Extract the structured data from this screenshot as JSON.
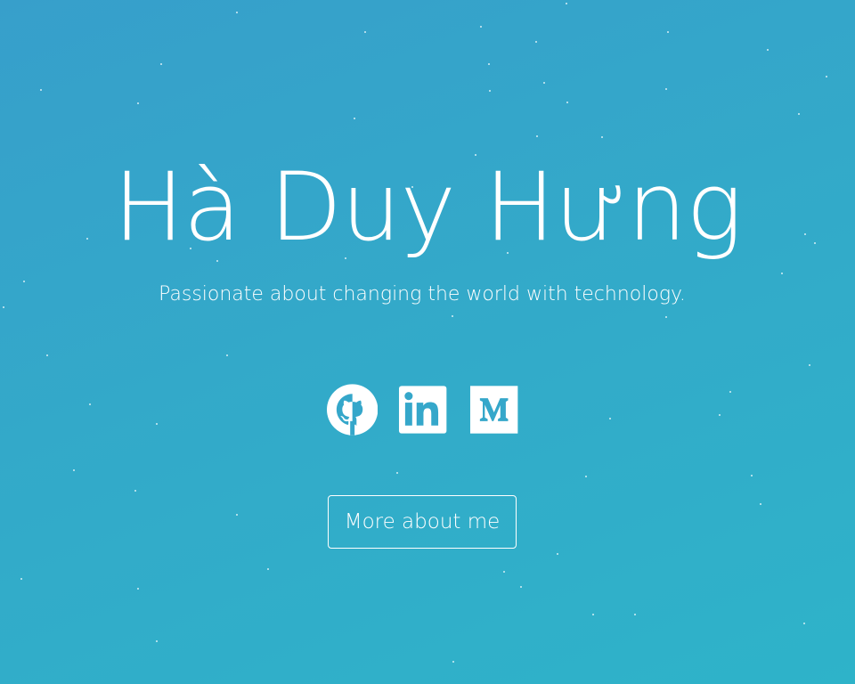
{
  "hero": {
    "name": "Hà Duy Hưng",
    "tagline": "Passionate about changing the world with technology.",
    "background_colors": [
      "#379fcb",
      "#2eb3c9"
    ]
  },
  "socials": [
    {
      "icon": "github-icon",
      "label": "GitHub"
    },
    {
      "icon": "linkedin-icon",
      "label": "LinkedIn"
    },
    {
      "icon": "medium-icon",
      "label": "Medium"
    }
  ],
  "cta": {
    "label": "More about me"
  }
}
